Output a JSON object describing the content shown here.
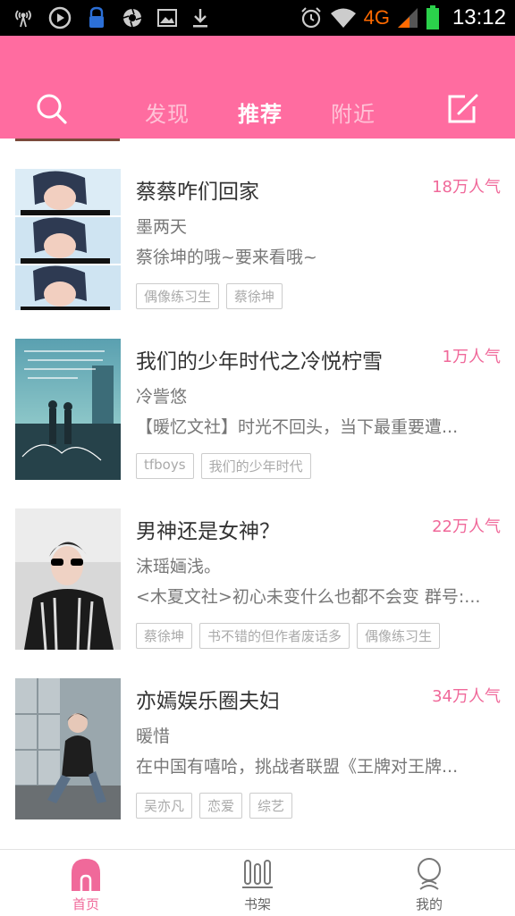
{
  "status_bar": {
    "network": "4G",
    "time": "13:12",
    "left_icons": [
      "signal-radio-icon",
      "play-circle-icon",
      "lock-icon",
      "aperture-icon",
      "image-icon",
      "download-icon"
    ],
    "right_icons": [
      "alarm-icon",
      "wifi-icon",
      "cell-signal-icon",
      "battery-icon"
    ]
  },
  "header": {
    "tabs": [
      {
        "label": "发现"
      },
      {
        "label": "推荐"
      },
      {
        "label": "附近"
      }
    ],
    "active_tab": "推荐",
    "accent_color": "#ff6ca0"
  },
  "books": [
    {
      "title": "蔡蔡咋们回家",
      "popularity": "18万人气",
      "author": "墨两天",
      "desc": "蔡徐坤的哦~要来看哦~",
      "tags": [
        "偶像练习生",
        "蔡徐坤"
      ]
    },
    {
      "title": "我们的少年时代之冷悦柠雪",
      "popularity": "1万人气",
      "author": "冷訾悠",
      "desc": "【暖忆文社】时光不回头，当下最重要遭...",
      "tags": [
        "tfboys",
        "我们的少年时代"
      ]
    },
    {
      "title": "男神还是女神？",
      "popularity": "22万人气",
      "author": "沫瑶婳浅。",
      "desc": "<木夏文社>初心未变什么也都不会变 群号:...",
      "tags": [
        "蔡徐坤",
        "书不错的但作者废话多",
        "偶像练习生"
      ]
    },
    {
      "title": "亦嫣娱乐圈夫妇",
      "popularity": "34万人气",
      "author": "暖惜",
      "desc": "在中国有嘻哈，挑战者联盟《王牌对王牌...",
      "tags": [
        "吴亦凡",
        "恋爱",
        "综艺"
      ]
    }
  ],
  "bottom_nav": [
    {
      "label": "首页"
    },
    {
      "label": "书架"
    },
    {
      "label": "我的"
    }
  ],
  "active_nav": "首页"
}
